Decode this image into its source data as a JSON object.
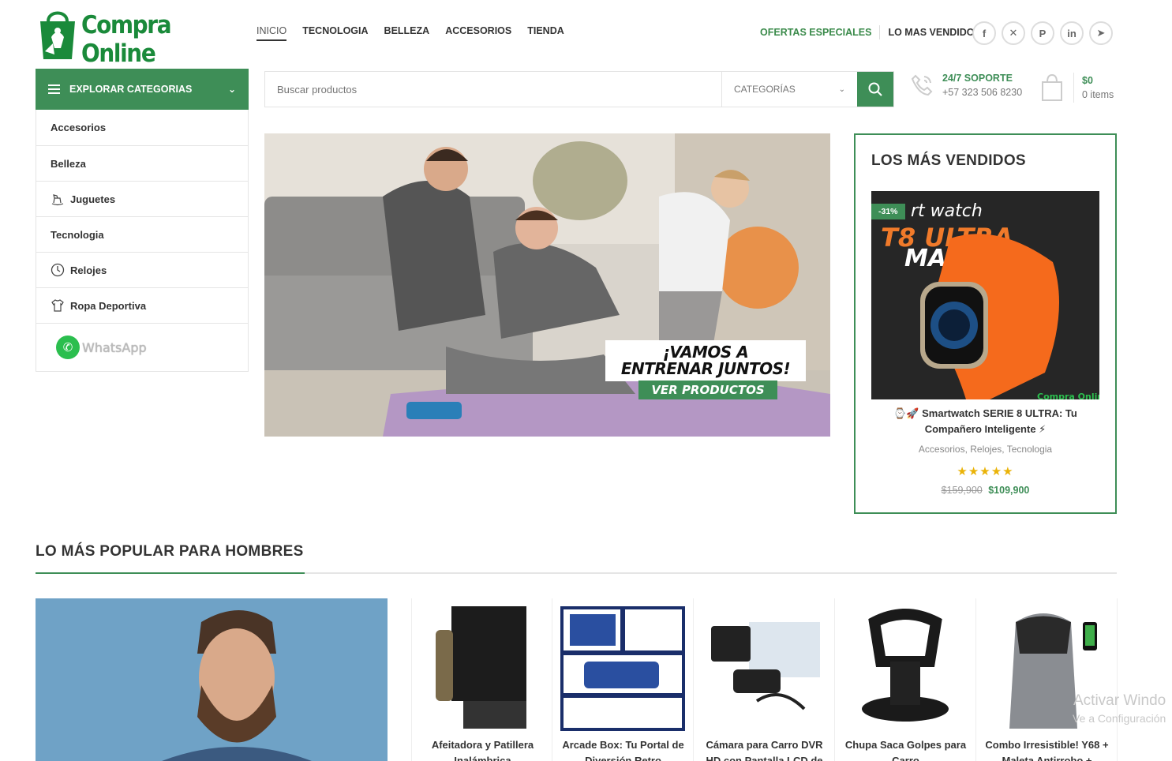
{
  "brand": {
    "name": "Compra Online"
  },
  "nav": {
    "items": [
      {
        "label": "INICIO"
      },
      {
        "label": "TECNOLOGIA"
      },
      {
        "label": "BELLEZA"
      },
      {
        "label": "ACCESORIOS"
      },
      {
        "label": "TIENDA"
      }
    ],
    "offers": "OFERTAS ESPECIALES",
    "bestsellers": "LO MAS VENDIDO"
  },
  "social": [
    "facebook-icon",
    "x-icon",
    "pinterest-icon",
    "linkedin-icon",
    "telegram-icon"
  ],
  "categories": {
    "button_label": "EXPLORAR CATEGORIAS",
    "items": [
      {
        "label": "Accesorios",
        "icon": ""
      },
      {
        "label": "Belleza",
        "icon": ""
      },
      {
        "label": "Juguetes",
        "icon": "rocking-horse-icon"
      },
      {
        "label": "Tecnologia",
        "icon": ""
      },
      {
        "label": "Relojes",
        "icon": "clock-icon"
      },
      {
        "label": "Ropa Deportiva",
        "icon": "tshirt-icon"
      }
    ],
    "whatsapp": "WhatsApp"
  },
  "search": {
    "placeholder": "Buscar productos",
    "category_select": "CATEGORÍAS"
  },
  "support": {
    "title": "24/7 SOPORTE",
    "phone": "+57 323 506 8230"
  },
  "cart": {
    "total": "$0",
    "items": "0 items"
  },
  "hero": {
    "line1": "¡VAMOS A",
    "line2": "ENTRENAR JUNTOS!",
    "cta": "VER PRODUCTOS"
  },
  "best_seller": {
    "title": "LOS MÁS VENDIDOS",
    "badge": "-31%",
    "image_text": {
      "line1": "rt watch",
      "line2": "T8 ULTRA",
      "line3": "MAX",
      "watermark": "Compra Online"
    },
    "name_line1": "⌚🚀 Smartwatch SERIE 8 ULTRA: Tu",
    "name_line2": "Compañero Inteligente ⚡",
    "categories": "Accesorios, Relojes, Tecnologia",
    "rating": 5,
    "stars": "★★★★★",
    "old_price": "$159,900",
    "price": "$109,900"
  },
  "popular": {
    "title": "LO MÁS POPULAR PARA HOMBRES",
    "products": [
      {
        "line1": "Afeitadora y Patillera",
        "line2": "Inalámbrica"
      },
      {
        "line1": "Arcade Box: Tu Portal de",
        "line2": "Diversión Retro"
      },
      {
        "line1": "Cámara para Carro DVR",
        "line2": "HD con Pantalla LCD de"
      },
      {
        "line1": "Chupa Saca Golpes para",
        "line2": "Carro"
      },
      {
        "line1": "Combo Irresistible! Y68 +",
        "line2": "Maleta Antirrobo +"
      }
    ]
  },
  "watermark": {
    "line1": "Activar Windo",
    "line2": "Ve a Configuración"
  },
  "colors": {
    "accent": "#3e8e57",
    "brand": "#1a8a3a",
    "star": "#eab308"
  }
}
